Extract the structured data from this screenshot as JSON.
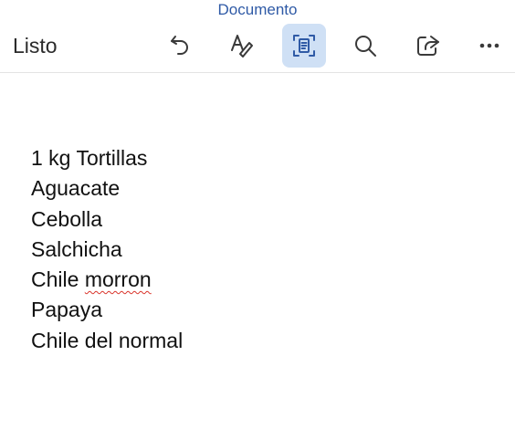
{
  "header": {
    "title": "Documento",
    "done_label": "Listo"
  },
  "toolbar": {
    "buttons": [
      {
        "icon": "undo-icon",
        "active": false
      },
      {
        "icon": "format-text-icon",
        "active": false
      },
      {
        "icon": "page-view-icon",
        "active": true
      },
      {
        "icon": "search-icon",
        "active": false
      },
      {
        "icon": "share-icon",
        "active": false
      },
      {
        "icon": "more-icon",
        "active": false
      }
    ],
    "active_color": "#cfe0f5",
    "icon_color": "#3a3a3a",
    "active_icon_color": "#2f5aa6"
  },
  "document": {
    "lines": [
      {
        "prefix": "1 kg Tortillas",
        "flagged": ""
      },
      {
        "prefix": "Aguacate",
        "flagged": ""
      },
      {
        "prefix": "Cebolla",
        "flagged": ""
      },
      {
        "prefix": "Salchicha",
        "flagged": ""
      },
      {
        "prefix": "Chile ",
        "flagged": "morron"
      },
      {
        "prefix": "Papaya",
        "flagged": ""
      },
      {
        "prefix": "Chile del normal",
        "flagged": ""
      }
    ]
  }
}
